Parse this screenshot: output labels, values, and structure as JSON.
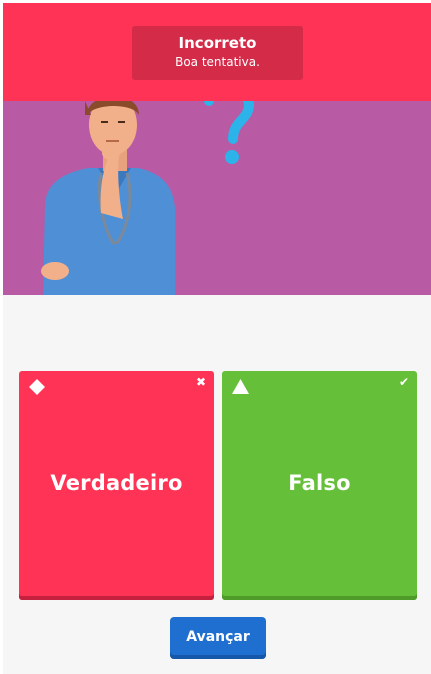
{
  "feedback": {
    "title": "Incorreto",
    "subtitle": "Boa tentativa."
  },
  "answers": [
    {
      "label": "Verdadeiro",
      "shape": "diamond-icon",
      "mark": "✖",
      "result": "incorrect",
      "color": "#ff3355"
    },
    {
      "label": "Falso",
      "shape": "triangle-icon",
      "mark": "✔",
      "result": "correct",
      "color": "#66bf39"
    }
  ],
  "next_button": {
    "label": "Avançar"
  },
  "colors": {
    "banner": "#ff3355",
    "illustration_bg": "#b85aa4",
    "button": "#1f6fd0"
  }
}
